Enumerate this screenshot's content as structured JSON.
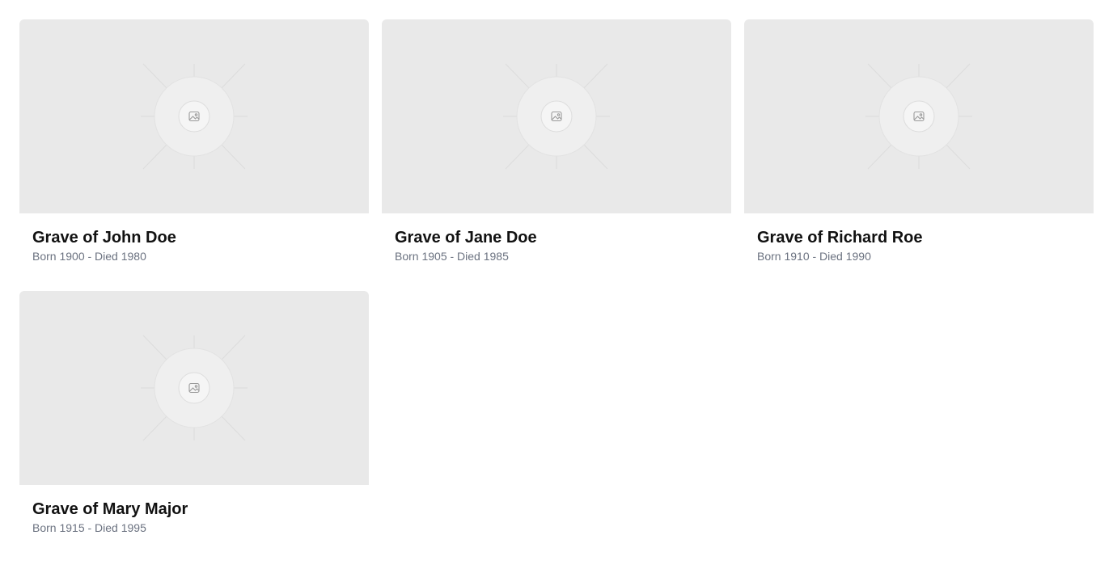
{
  "cards": [
    {
      "title": "Grave of John Doe",
      "subtitle": "Born 1900 - Died 1980",
      "image_icon": "image-placeholder-icon"
    },
    {
      "title": "Grave of Jane Doe",
      "subtitle": "Born 1905 - Died 1985",
      "image_icon": "image-placeholder-icon"
    },
    {
      "title": "Grave of Richard Roe",
      "subtitle": "Born 1910 - Died 1990",
      "image_icon": "image-placeholder-icon"
    },
    {
      "title": "Grave of Mary Major",
      "subtitle": "Born 1915 - Died 1995",
      "image_icon": "image-placeholder-icon"
    }
  ],
  "colors": {
    "placeholder_bg": "#e9e9e9",
    "title": "#111111",
    "subtitle": "#6b7280"
  }
}
